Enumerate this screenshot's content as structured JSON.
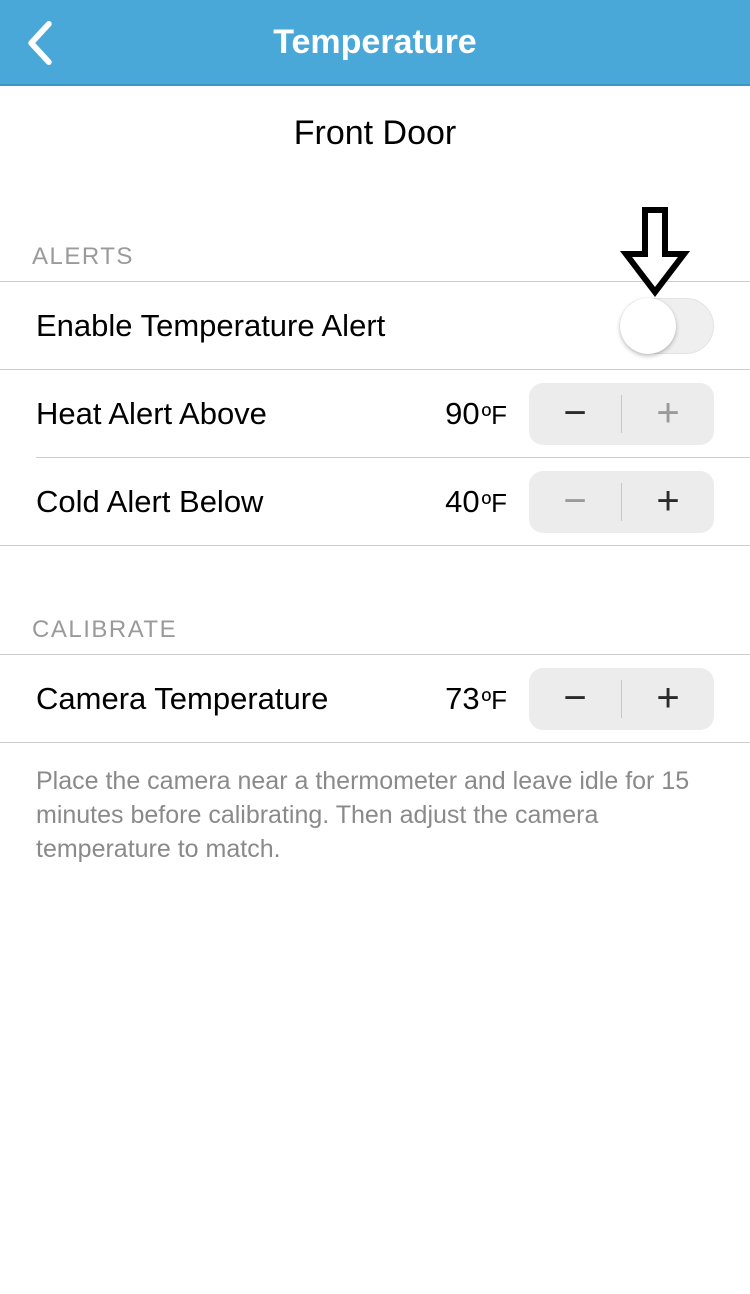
{
  "header": {
    "title": "Temperature"
  },
  "device": {
    "name": "Front Door"
  },
  "sections": {
    "alerts": {
      "heading": "ALERTS"
    },
    "calibrate": {
      "heading": "CALIBRATE"
    }
  },
  "alerts": {
    "enable_label": "Enable Temperature Alert",
    "enable_state": false,
    "heat": {
      "label": "Heat Alert Above",
      "value": "90",
      "unit": "ºF"
    },
    "cold": {
      "label": "Cold Alert Below",
      "value": "40",
      "unit": "ºF"
    }
  },
  "calibrate": {
    "camera": {
      "label": "Camera Temperature",
      "value": "73",
      "unit": "ºF"
    },
    "note": "Place the camera near a thermometer and leave idle for 15 minutes before calibrating. Then adjust the camera temperature to match."
  },
  "icons": {
    "back": "chevron-left",
    "annotation": "down-arrow"
  },
  "colors": {
    "header_bg": "#4aa8d8",
    "divider": "#cfcfcf",
    "muted_text": "#8a8a8a"
  }
}
